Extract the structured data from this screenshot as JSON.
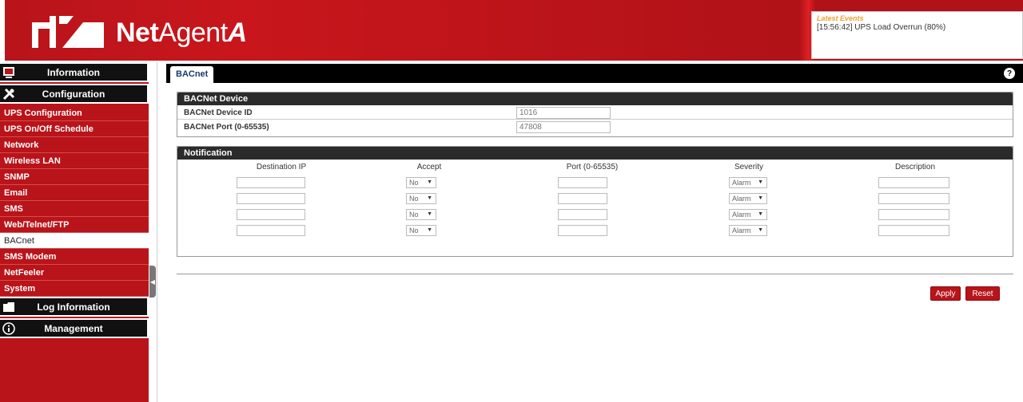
{
  "app": {
    "brand_prefix": "Net",
    "brand_mid": "Agent",
    "brand_suffix": "A"
  },
  "events": {
    "title": "Latest Events",
    "line": "[15:56:42] UPS Load Overrun (80%)"
  },
  "sidebar": {
    "sections": [
      {
        "label": "Information",
        "icon": "info-panel-icon"
      },
      {
        "label": "Configuration",
        "icon": "tools-icon"
      }
    ],
    "items": [
      {
        "label": "UPS Configuration"
      },
      {
        "label": "UPS On/Off Schedule"
      },
      {
        "label": "Network"
      },
      {
        "label": "Wireless LAN"
      },
      {
        "label": "SNMP"
      },
      {
        "label": "Email"
      },
      {
        "label": "SMS"
      },
      {
        "label": "Web/Telnet/FTP"
      },
      {
        "label": "BACnet"
      },
      {
        "label": "SMS Modem"
      },
      {
        "label": "NetFeeler"
      },
      {
        "label": "System"
      }
    ],
    "bottom_sections": [
      {
        "label": "Log Information",
        "icon": "folder-icon"
      },
      {
        "label": "Management",
        "icon": "info-circle-icon"
      }
    ],
    "active_item": "BACnet"
  },
  "tabs": [
    {
      "label": "BACnet"
    }
  ],
  "device": {
    "title": "BACNet Device",
    "id_label": "BACNet Device ID",
    "id_value": "1016",
    "port_label": "BACNet Port (0-65535)",
    "port_value": "47808"
  },
  "notification": {
    "title": "Notification",
    "columns": [
      "Destination IP",
      "Accept",
      "Port (0-65535)",
      "Severity",
      "Description"
    ],
    "rows": [
      {
        "accept": "No",
        "severity": "Alarm"
      },
      {
        "accept": "No",
        "severity": "Alarm"
      },
      {
        "accept": "No",
        "severity": "Alarm"
      },
      {
        "accept": "No",
        "severity": "Alarm"
      }
    ]
  },
  "buttons": {
    "apply": "Apply",
    "reset": "Reset"
  },
  "colors": {
    "brand_red": "#b8141a",
    "dark": "#2b2b2b",
    "event_title": "#f0a030"
  }
}
